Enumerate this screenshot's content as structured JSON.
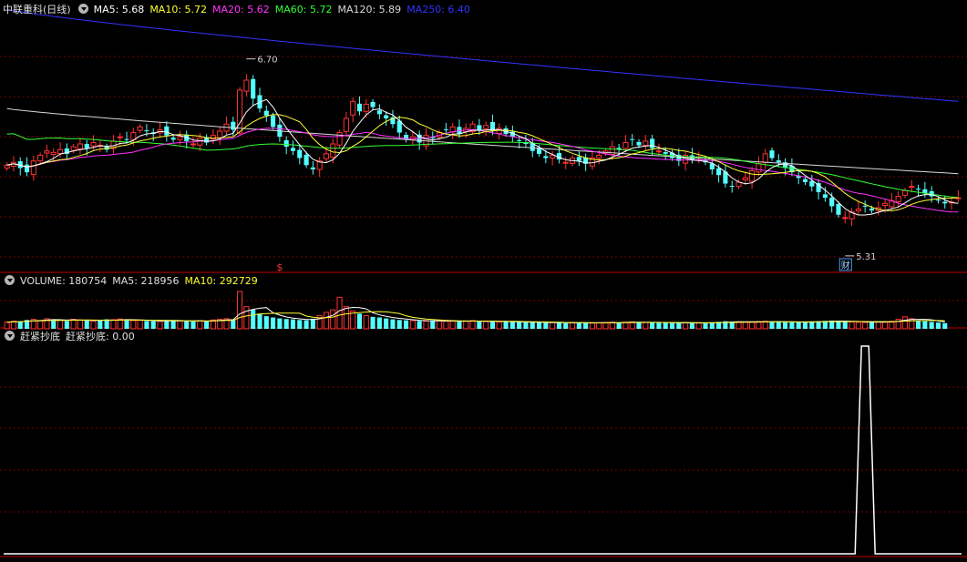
{
  "header": {
    "title": "中联重科(日线)",
    "ma": [
      {
        "label": "MA5: 5.68",
        "color": "#ffffff"
      },
      {
        "label": "MA10: 5.72",
        "color": "#ffff33"
      },
      {
        "label": "MA20: 5.62",
        "color": "#ff33ff"
      },
      {
        "label": "MA60: 5.72",
        "color": "#33ff33"
      },
      {
        "label": "MA120: 5.89",
        "color": "#d8d8d8"
      },
      {
        "label": "MA250: 6.40",
        "color": "#3333ff"
      }
    ]
  },
  "volume_header": {
    "items": [
      {
        "label": "VOLUME: 180754",
        "color": "#e0e0e0"
      },
      {
        "label": "MA5: 218956",
        "color": "#e0e0e0"
      },
      {
        "label": "MA10: 292729",
        "color": "#ffff33"
      }
    ]
  },
  "indicator_header": {
    "title": "赶紧抄底",
    "value_label": "赶紧抄底: 0.00"
  },
  "annotations": {
    "high_label": "6.70",
    "low_label": "5.31",
    "dollar_marker": "$",
    "cai_badge": "财"
  },
  "colors": {
    "up": "#ff3232",
    "down": "#54ffff",
    "grid": "#7a0000",
    "border": "#c00000"
  },
  "chart_data": [
    {
      "type": "candlestick",
      "title": "中联重科(日线)",
      "ylim": [
        5.2,
        7.0
      ],
      "high_marker": 6.7,
      "low_marker": 5.31,
      "close": [
        5.95,
        5.97,
        5.93,
        5.9,
        5.98,
        6.02,
        6.05,
        6.04,
        6.06,
        6.03,
        6.08,
        6.1,
        6.07,
        6.11,
        6.09,
        6.06,
        6.12,
        6.15,
        6.13,
        6.18,
        6.22,
        6.19,
        6.17,
        6.2,
        6.16,
        6.13,
        6.15,
        6.12,
        6.1,
        6.14,
        6.11,
        6.16,
        6.19,
        6.24,
        6.2,
        6.48,
        6.55,
        6.42,
        6.35,
        6.3,
        6.22,
        6.15,
        6.08,
        6.05,
        6.0,
        5.95,
        5.92,
        5.98,
        6.03,
        6.1,
        6.18,
        6.28,
        6.4,
        6.33,
        6.38,
        6.36,
        6.31,
        6.28,
        6.24,
        6.18,
        6.13,
        6.15,
        6.11,
        6.16,
        6.14,
        6.18,
        6.2,
        6.22,
        6.17,
        6.21,
        6.24,
        6.2,
        6.23,
        6.19,
        6.21,
        6.17,
        6.15,
        6.12,
        6.1,
        6.05,
        6.03,
        6.0,
        6.02,
        5.99,
        5.97,
        6.0,
        5.98,
        5.96,
        6.0,
        6.02,
        6.05,
        6.08,
        6.06,
        6.11,
        6.13,
        6.09,
        6.12,
        6.07,
        6.05,
        6.03,
        6.0,
        5.98,
        6.02,
        5.99,
        6.01,
        5.97,
        5.92,
        5.88,
        5.82,
        5.8,
        5.83,
        5.86,
        5.91,
        5.96,
        6.03,
        6.0,
        5.97,
        5.93,
        5.9,
        5.86,
        5.83,
        5.8,
        5.76,
        5.72,
        5.66,
        5.6,
        5.58,
        5.62,
        5.64,
        5.66,
        5.63,
        5.65,
        5.68,
        5.7,
        5.73,
        5.77,
        5.8,
        5.78,
        5.75,
        5.73,
        5.7,
        5.68,
        5.69,
        5.72
      ],
      "volume": [
        210000,
        240000,
        230000,
        280000,
        300000,
        260000,
        320000,
        290000,
        270000,
        250000,
        300000,
        280000,
        260000,
        240000,
        270000,
        300000,
        290000,
        310000,
        280000,
        260000,
        270000,
        250000,
        240000,
        230000,
        260000,
        270000,
        250000,
        240000,
        230000,
        260000,
        250000,
        280000,
        300000,
        320000,
        290000,
        1180000,
        700000,
        600000,
        480000,
        400000,
        360000,
        330000,
        310000,
        300000,
        280000,
        270000,
        320000,
        420000,
        520000,
        600000,
        1000000,
        700000,
        560000,
        480000,
        420000,
        380000,
        360000,
        330000,
        300000,
        280000,
        270000,
        260000,
        250000,
        240000,
        260000,
        250000,
        240000,
        250000,
        230000,
        240000,
        260000,
        240000,
        230000,
        240000,
        220000,
        230000,
        210000,
        220000,
        200000,
        210000,
        200000,
        190000,
        200000,
        190000,
        180000,
        190000,
        200000,
        190000,
        180000,
        190000,
        200000,
        210000,
        200000,
        210000,
        220000,
        210000,
        200000,
        190000,
        200000,
        190000,
        180000,
        190000,
        200000,
        190000,
        180000,
        190000,
        200000,
        220000,
        240000,
        230000,
        220000,
        210000,
        220000,
        230000,
        240000,
        230000,
        220000,
        210000,
        200000,
        210000,
        220000,
        230000,
        240000,
        250000,
        260000,
        240000,
        230000,
        220000,
        210000,
        200000,
        210000,
        220000,
        230000,
        240000,
        300000,
        380000,
        320000,
        260000,
        240000,
        220000,
        200000,
        180754
      ],
      "ma5_last": 5.68,
      "ma10_last": 5.72,
      "ma20_last": 5.62,
      "ma60_last": 5.72,
      "ma120_last": 5.89,
      "ma250_last": 6.4
    },
    {
      "type": "bar",
      "title": "VOLUME",
      "values_ref": "volume",
      "last": 180754,
      "ma5": 218956,
      "ma10": 292729
    },
    {
      "type": "line",
      "title": "赶紧抄底",
      "ylim": [
        0,
        1
      ],
      "last": 0.0,
      "signal_index": 129
    }
  ]
}
